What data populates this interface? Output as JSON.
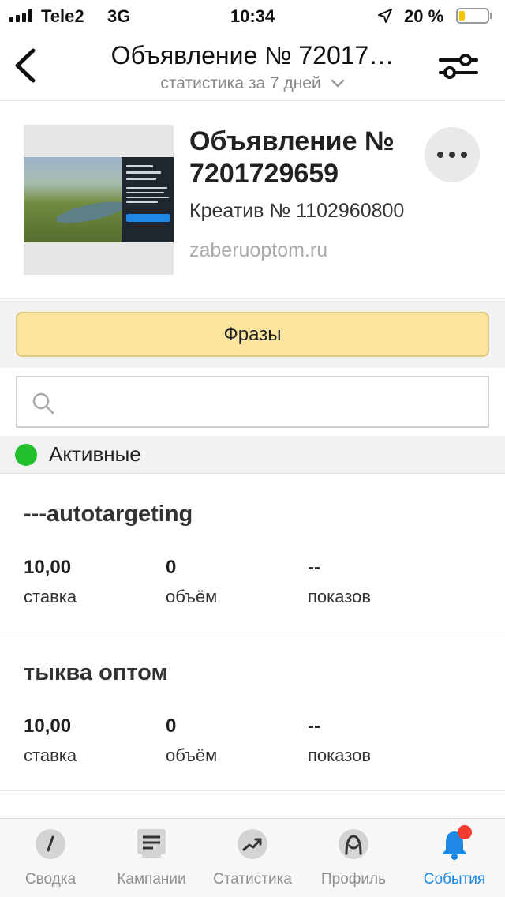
{
  "status_bar": {
    "carrier": "Tele2",
    "network": "3G",
    "time": "10:34",
    "battery_percent": "20 %",
    "battery_level": 0.2
  },
  "header": {
    "title": "Объявление № 72017…",
    "subtitle": "статистика за 7 дней",
    "back_icon": "chevron-left-icon",
    "filter_icon": "sliders-icon"
  },
  "ad": {
    "title": "Объявление № 7201729659",
    "creative": "Креатив № 1102960800",
    "domain": "zaberuoptom.ru"
  },
  "phrases_button_label": "Фразы",
  "search": {
    "placeholder": ""
  },
  "section": {
    "label": "Активные",
    "status_color": "#22c02a"
  },
  "phrases": [
    {
      "name": "---autotargeting",
      "bid": "10,00",
      "bid_label": "ставка",
      "volume": "0",
      "volume_label": "объём",
      "impressions": "--",
      "impressions_label": "показов"
    },
    {
      "name": "тыква оптом",
      "bid": "10,00",
      "bid_label": "ставка",
      "volume": "0",
      "volume_label": "объём",
      "impressions": "--",
      "impressions_label": "показов"
    }
  ],
  "tabbar": {
    "items": [
      {
        "label": "Сводка",
        "icon": "gauge-icon"
      },
      {
        "label": "Кампании",
        "icon": "document-icon"
      },
      {
        "label": "Статистика",
        "icon": "trend-icon"
      },
      {
        "label": "Профиль",
        "icon": "profile-icon"
      },
      {
        "label": "События",
        "icon": "bell-icon",
        "active": true
      }
    ],
    "accent_color": "#1e88e5",
    "badge_color": "#f23b2f"
  }
}
